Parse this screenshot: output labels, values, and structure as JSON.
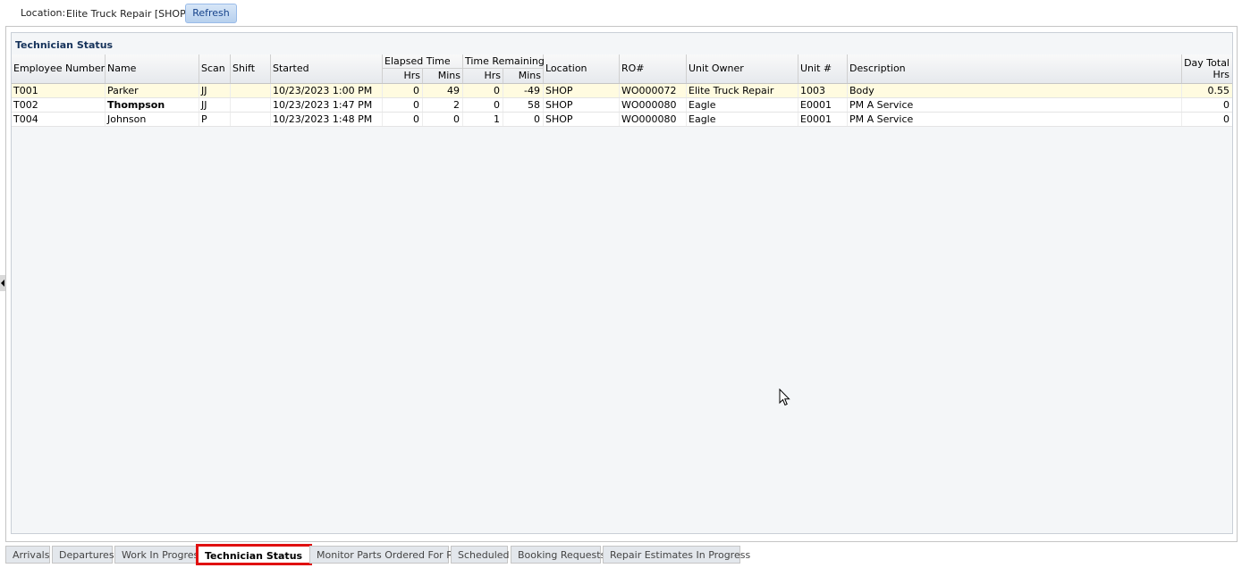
{
  "toolbar": {
    "location_label": "Location:",
    "location_value": "Elite Truck Repair [SHOP]",
    "refresh_label": "Refresh"
  },
  "panel": {
    "title": "Technician Status"
  },
  "columns": {
    "employee_number": "Employee Number",
    "name": "Name",
    "scan": "Scan",
    "shift": "Shift",
    "started": "Started",
    "elapsed_time": "Elapsed Time",
    "elapsed_hrs": "Hrs",
    "elapsed_mins": "Mins",
    "time_remaining": "Time Remaining",
    "remaining_hrs": "Hrs",
    "remaining_mins": "Mins",
    "location": "Location",
    "ro": "RO#",
    "unit_owner": "Unit Owner",
    "unit_no": "Unit #",
    "description": "Description",
    "day_total": "Day Total",
    "day_total_hrs": "Hrs"
  },
  "rows": [
    {
      "employee": "T001",
      "name": "Parker",
      "scan": "JJ",
      "shift": "",
      "started": "10/23/2023 1:00 PM",
      "elapsed_hrs": "0",
      "elapsed_mins": "49",
      "remaining_hrs": "0",
      "remaining_mins": "-49",
      "location": "SHOP",
      "ro": "WO000072",
      "unit_owner": "Elite Truck Repair",
      "unit": "1003",
      "description": "Body",
      "day_total": "0.55"
    },
    {
      "employee": "T002",
      "name": "Thompson",
      "scan": "JJ",
      "shift": "",
      "started": "10/23/2023 1:47 PM",
      "elapsed_hrs": "0",
      "elapsed_mins": "2",
      "remaining_hrs": "0",
      "remaining_mins": "58",
      "location": "SHOP",
      "ro": "WO000080",
      "unit_owner": "Eagle",
      "unit": "E0001",
      "description": "PM A Service",
      "day_total": "0"
    },
    {
      "employee": "T004",
      "name": "Johnson",
      "scan": "P",
      "shift": "",
      "started": "10/23/2023 1:48 PM",
      "elapsed_hrs": "0",
      "elapsed_mins": "0",
      "remaining_hrs": "1",
      "remaining_mins": "0",
      "location": "SHOP",
      "ro": "WO000080",
      "unit_owner": "Eagle",
      "unit": "E0001",
      "description": "PM A Service",
      "day_total": "0"
    }
  ],
  "tabs": [
    {
      "label": "Arrivals"
    },
    {
      "label": "Departures"
    },
    {
      "label": "Work In Progress"
    },
    {
      "label": "Technician Status"
    },
    {
      "label": "Monitor Parts Ordered For RO"
    },
    {
      "label": "Scheduled"
    },
    {
      "label": "Booking Requests"
    },
    {
      "label": "Repair Estimates In Progress"
    }
  ],
  "colors": {
    "active_tab_highlight": "#e01010",
    "selected_row": "#fffbe0",
    "panel_title": "#15325a"
  }
}
